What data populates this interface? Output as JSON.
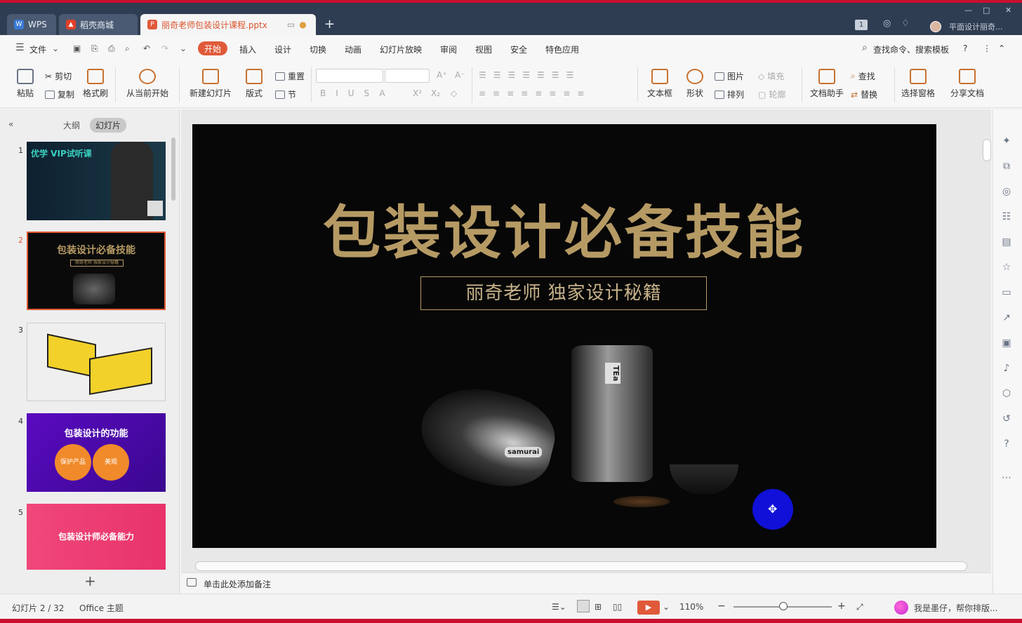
{
  "titlebar": {
    "tabs": [
      {
        "label": "WPS",
        "icon": "wps-logo-icon"
      },
      {
        "label": "稻壳商城",
        "icon": "docer-icon"
      },
      {
        "label": "丽奇老师包装设计课程.pptx",
        "icon": "ppt-file-icon"
      }
    ],
    "badge": "1",
    "user_name": "平面设计丽奇..."
  },
  "menu": {
    "file": "文件",
    "items": [
      "开始",
      "插入",
      "设计",
      "切换",
      "动画",
      "幻灯片放映",
      "审阅",
      "视图",
      "安全",
      "特色应用"
    ],
    "search": "查找命令、搜索模板",
    "help": "?"
  },
  "ribbon": {
    "paste": "粘贴",
    "cut": "剪切",
    "copy": "复制",
    "format_painter": "格式刷",
    "from_current": "从当前开始",
    "new_slide": "新建幻灯片",
    "layout": "版式",
    "reset": "重置",
    "section": "节",
    "textbox": "文本框",
    "shape": "形状",
    "picture": "图片",
    "arrange": "排列",
    "fill": "填充",
    "outline": "轮廓",
    "doc_assistant": "文档助手",
    "find": "查找",
    "replace": "替换",
    "select_pane": "选择窗格",
    "share": "分享文档"
  },
  "left_panel": {
    "tab_outline": "大纲",
    "tab_slides": "幻灯片",
    "slides": [
      {
        "num": "1",
        "title": "优学 VIP试听课"
      },
      {
        "num": "2",
        "title": "包装设计必备技能",
        "subtitle": "丽奇老师 独家设计秘籍"
      },
      {
        "num": "3",
        "title": ""
      },
      {
        "num": "4",
        "title": "包装设计的功能",
        "labels": [
          "保护产品",
          "美观"
        ]
      },
      {
        "num": "5",
        "title": "包装设计师必备能力"
      }
    ]
  },
  "slide": {
    "title": "包装设计必备技能",
    "subtitle": "丽奇老师 独家设计秘籍",
    "product_labels": [
      "TEa",
      "samurai"
    ]
  },
  "notes": {
    "placeholder": "单击此处添加备注"
  },
  "status": {
    "slide_counter": "幻灯片 2 / 32",
    "theme": "Office 主题",
    "zoom": "110%",
    "assistant": "我是墨仔，帮你排版..."
  },
  "colors": {
    "accent": "#e05a3a",
    "titlebar": "#2f3d52",
    "gold": "#b69a64"
  }
}
